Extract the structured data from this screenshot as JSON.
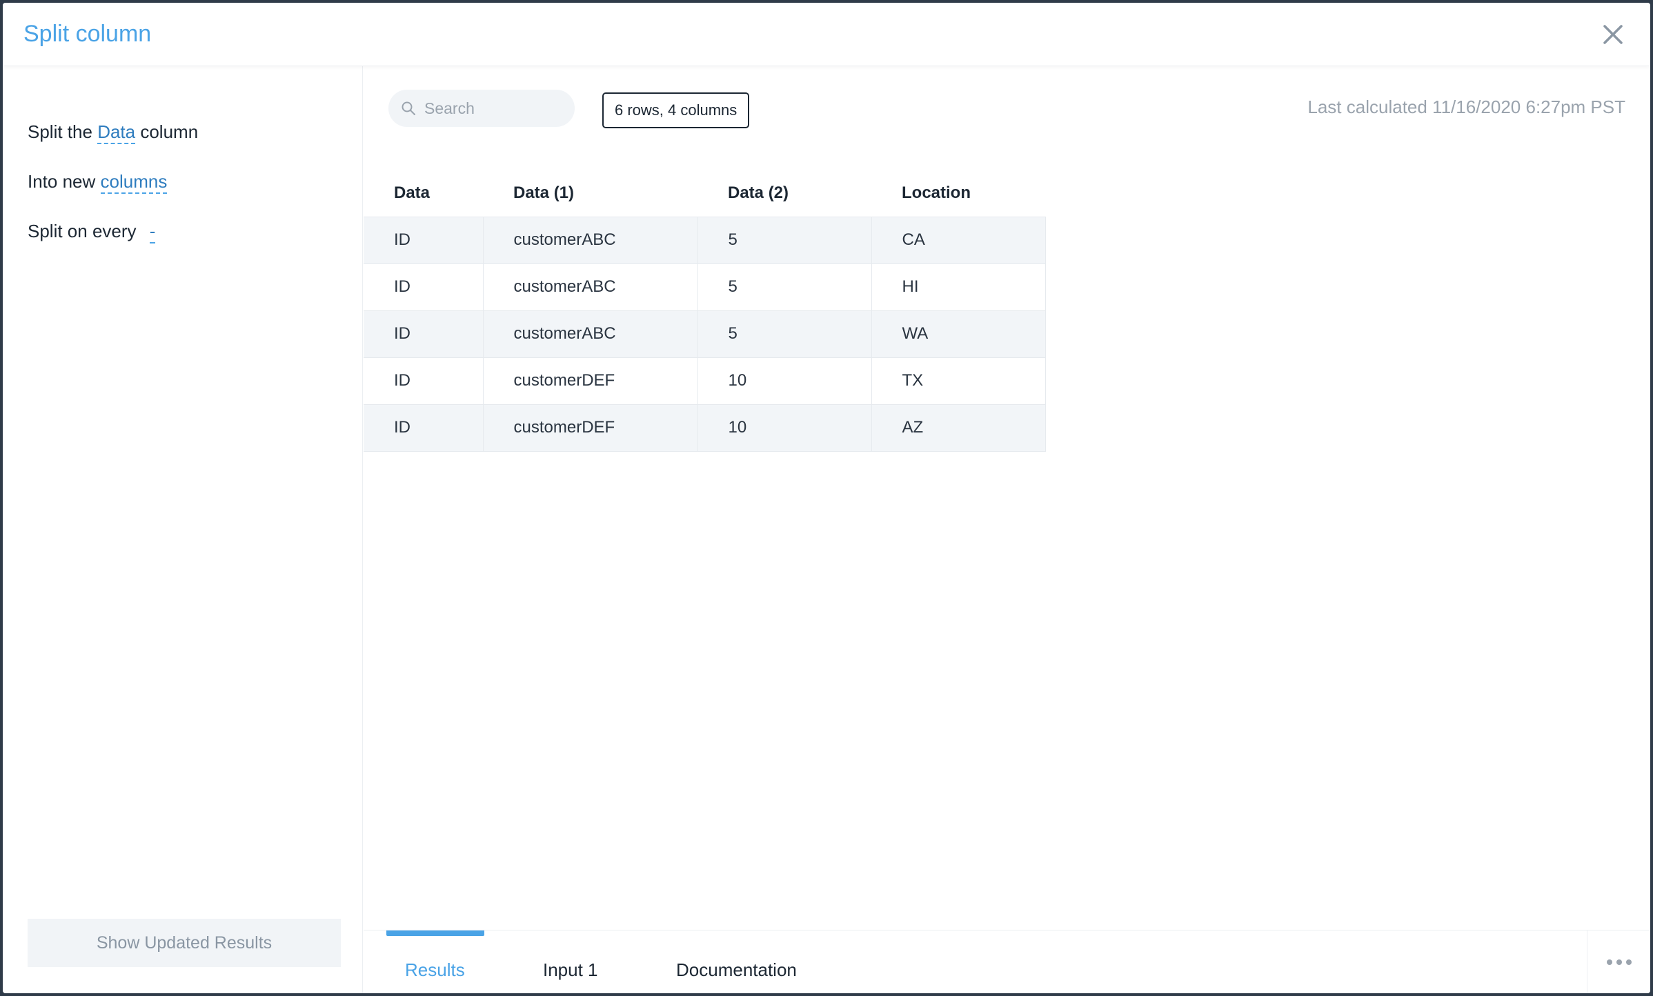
{
  "header": {
    "title": "Split column"
  },
  "config": {
    "line1": {
      "prefix": "Split the",
      "link": "Data",
      "suffix": "column"
    },
    "line2": {
      "prefix": "Into new",
      "link": "columns"
    },
    "line3": {
      "prefix": "Split on every",
      "link": "-"
    },
    "show_button": "Show Updated Results"
  },
  "toolbar": {
    "search_placeholder": "Search",
    "badge": "6 rows, 4 columns",
    "last_calculated": "Last calculated 11/16/2020 6:27pm PST"
  },
  "table": {
    "columns": [
      "Data",
      "Data (1)",
      "Data (2)",
      "Location"
    ],
    "rows": [
      [
        "ID",
        "customerABC",
        "5",
        "CA"
      ],
      [
        "ID",
        "customerABC",
        "5",
        "HI"
      ],
      [
        "ID",
        "customerABC",
        "5",
        "WA"
      ],
      [
        "ID",
        "customerDEF",
        "10",
        "TX"
      ],
      [
        "ID",
        "customerDEF",
        "10",
        "AZ"
      ]
    ]
  },
  "tabs": [
    {
      "label": "Results",
      "active": true
    },
    {
      "label": "Input 1",
      "active": false
    },
    {
      "label": "Documentation",
      "active": false
    }
  ],
  "colors": {
    "accent": "#4aa3e6",
    "link": "#2f7dbf",
    "text": "#1c2733",
    "muted": "#9aa3ad"
  }
}
